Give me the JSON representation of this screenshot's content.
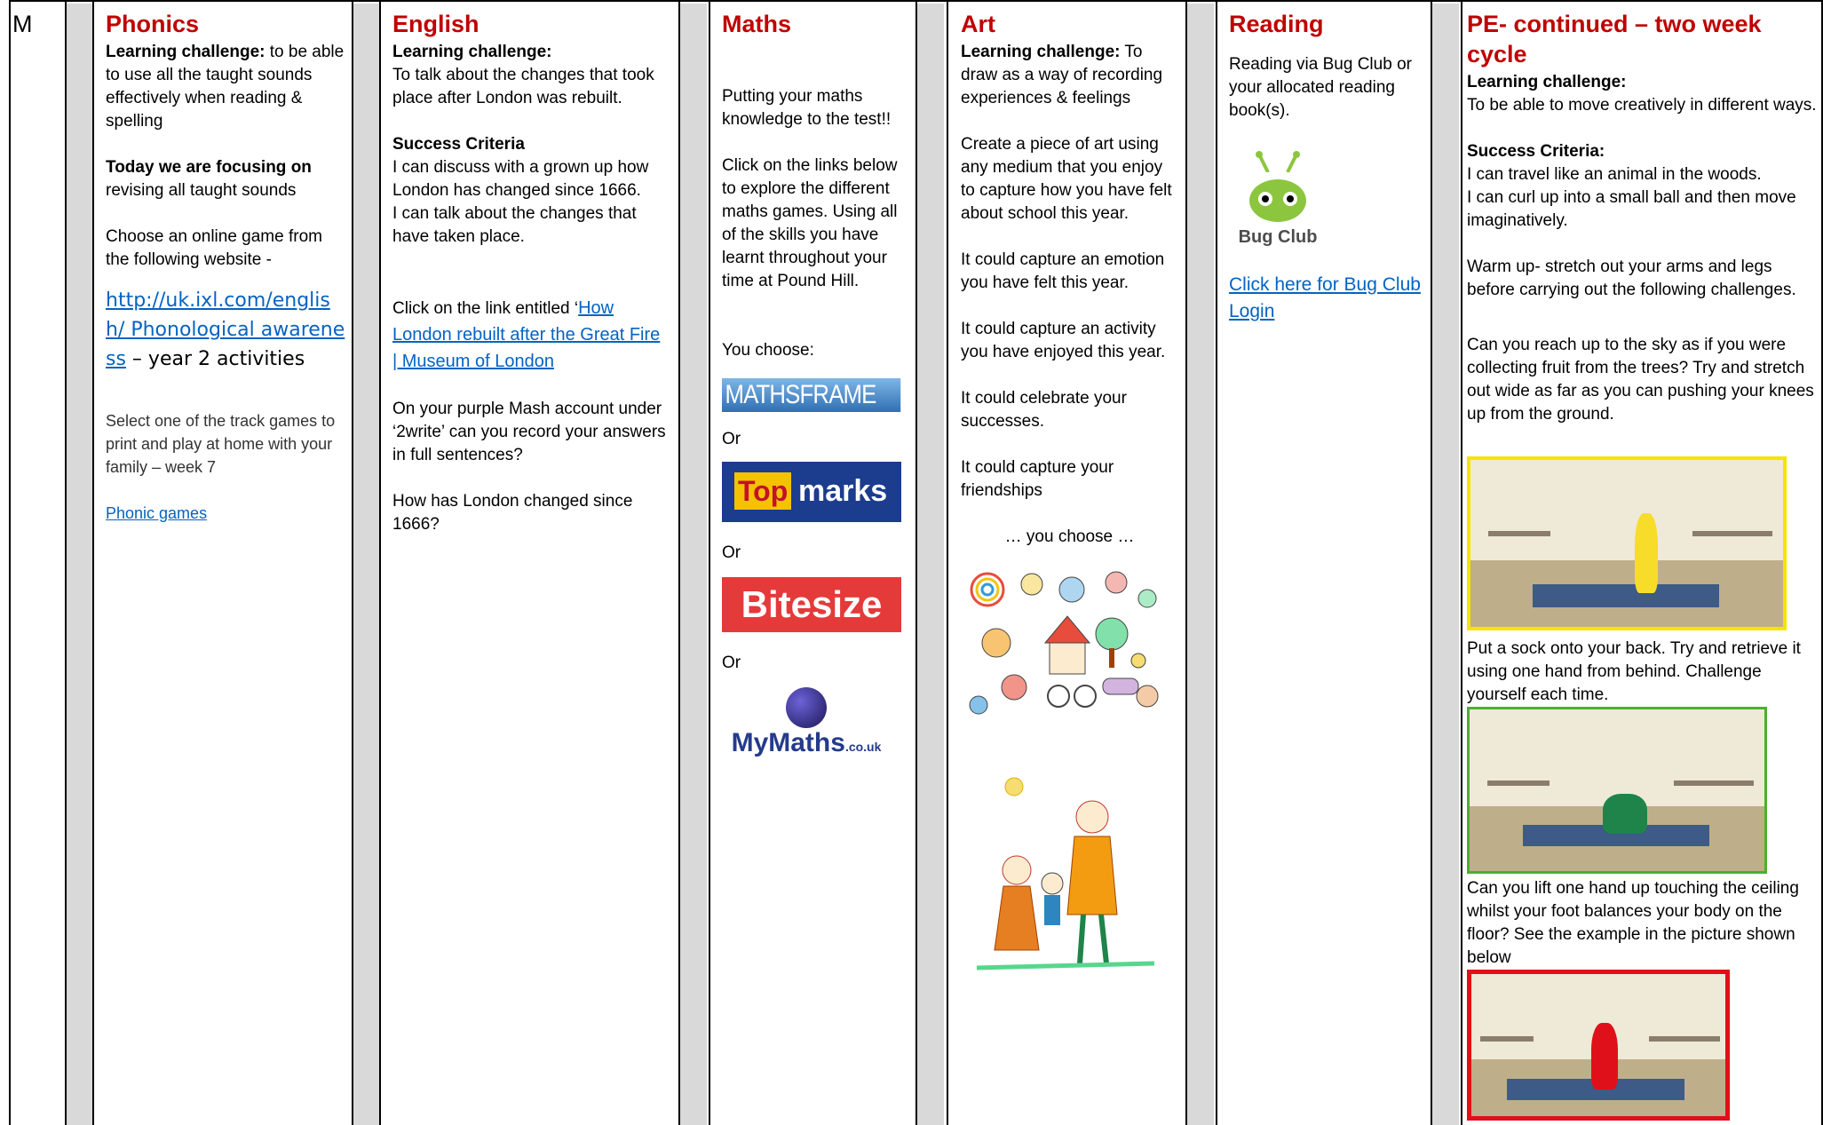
{
  "day": "M",
  "phonics": {
    "title": "Phonics",
    "lc_label": "Learning challenge:",
    "lc_text": " to be able to use all the taught sounds effectively when reading & spelling",
    "focus_label": "Today we are focusing on",
    "focus_text": " revising all taught sounds",
    "choose_text": "Choose an online game from the following website -",
    "link_text": "http://uk.ixl.com/english/ Phonological awareness",
    "link_suffix": " – year 2 activities",
    "select_text": "Select one of the track games to print and play at home with your family – week 7",
    "games_link": "Phonic games"
  },
  "english": {
    "title": "English",
    "lc_label": "Learning challenge:",
    "lc_text": "To talk about the changes that took place after London was rebuilt.",
    "sc_label": "Success Criteria",
    "sc_1": "I can discuss with a grown up how London has changed since 1666.",
    "sc_2": "I can talk about the changes that have taken place.",
    "click_prefix": "Click on the link entitled ‘",
    "click_link": "How London rebuilt after the Great Fire | Museum of London",
    "purple_text": "On your purple Mash account under ‘2write’ can you record your answers in full sentences?",
    "question": "How has London changed since 1666?"
  },
  "maths": {
    "title": "Maths",
    "intro": "Putting your maths knowledge to the test!!",
    "click_text": "Click on the links below to explore the different maths games. Using all of the skills you have learnt throughout your time at Pound Hill.",
    "you_choose": "You choose:",
    "or_1": "Or",
    "or_2": "Or",
    "or_3": "Or",
    "logo_mathsframe": "MATHSFRAME",
    "logo_top": "Top",
    "logo_marks": "marks",
    "logo_bitesize": "Bitesize",
    "logo_mymaths": "MyMaths",
    "logo_mymaths_suffix": ".co.uk"
  },
  "art": {
    "title": "Art",
    "lc_label": "Learning challenge:",
    "lc_text": " To draw as a way of recording experiences & feelings",
    "create_text": "Create a piece of art using any medium that you enjoy to capture how you have felt about school this year.",
    "emotion_text": "It could capture an emotion you have felt this year.",
    "activity_text": "It could capture an activity you have enjoyed this year.",
    "celebrate_text": "It could celebrate your successes.",
    "friendships_text": "It could capture your friendships",
    "you_choose": "… you choose …"
  },
  "reading": {
    "title": "Reading",
    "text": "Reading via Bug Club or your allocated reading book(s).",
    "logo_label": "Bug Club",
    "link_text": "Click here for Bug Club Login"
  },
  "pe": {
    "title": "PE- continued – two week cycle",
    "lc_label": "Learning challenge:",
    "lc_text": "To be able to move creatively in different ways.",
    "sc_label": "Success Criteria:",
    "sc_1": "I can travel like an animal in the woods.",
    "sc_2": "I can curl up into a small ball and then move imaginatively.",
    "warmup": "Warm up- stretch out your arms and legs before carrying out the following challenges.",
    "reach": "Can you reach up to the sky as if you were collecting fruit from the trees? Try and stretch out wide as far as you can pushing your knees up from the ground.",
    "sock": "Put a sock onto your back. Try and retrieve it using one hand from behind. Challenge yourself each time.",
    "lift": "Can you lift one hand up touching the ceiling whilst your foot balances your body on the floor? See the example in the picture shown below",
    "colors": {
      "photo1_border": "#f2e600",
      "photo2_border": "#4caf2e",
      "photo3_border": "#e0101a",
      "header_red": "#c00000",
      "link_blue": "#0563c1"
    }
  }
}
